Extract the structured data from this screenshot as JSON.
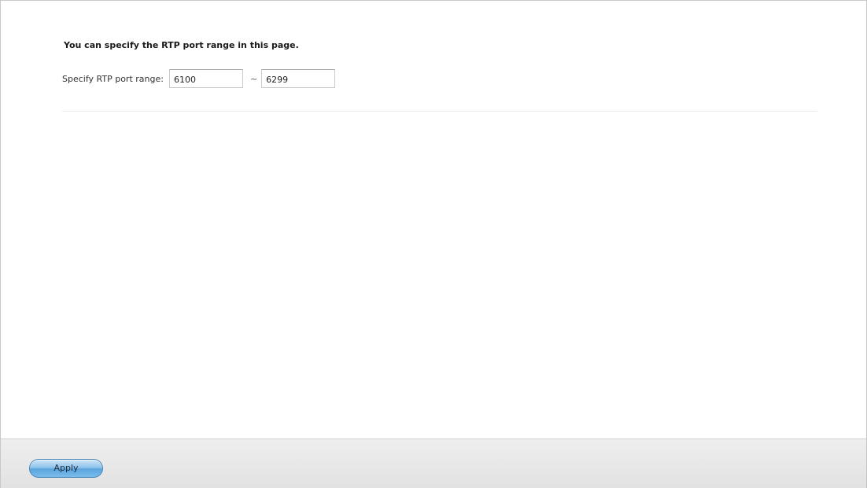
{
  "settings": {
    "heading": "You can specify the RTP port range in this page.",
    "port_range_label": "Specify RTP port range:",
    "port_start": "6100",
    "port_separator": "~",
    "port_end": "6299"
  },
  "footer": {
    "apply_label": "Apply"
  },
  "colors": {
    "apply_button": "#5aa5de",
    "footer_background": "#e8e8e8"
  }
}
